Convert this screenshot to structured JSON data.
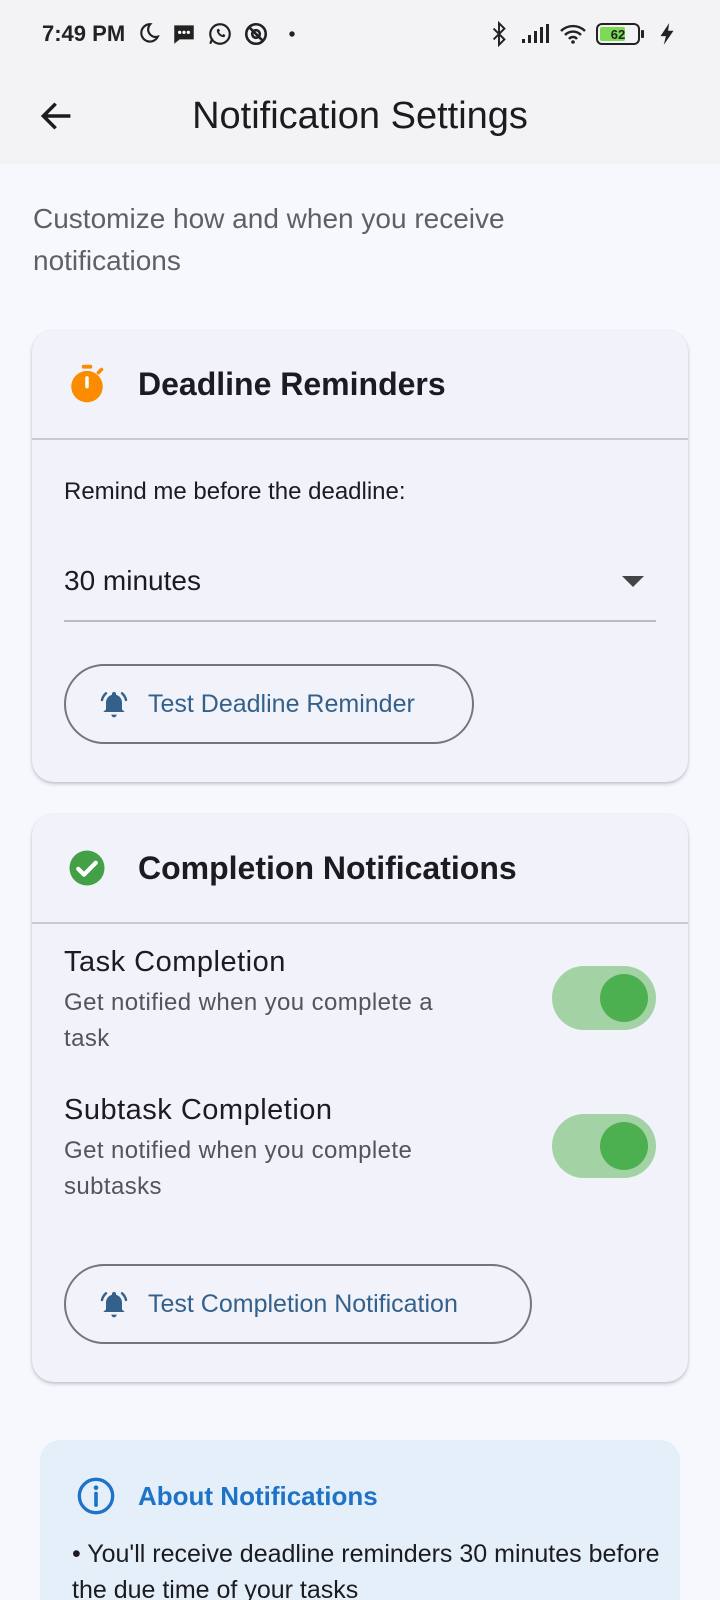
{
  "status_bar": {
    "time": "7:49 PM",
    "battery_level": "62",
    "left_icons": [
      "moon-icon",
      "message-icon",
      "whatsapp-icon",
      "at-sign-icon",
      "dot-icon"
    ],
    "right_icons": [
      "bluetooth-icon",
      "signal-icon",
      "wifi-icon",
      "battery-icon",
      "charging-icon"
    ]
  },
  "app_bar": {
    "title": "Notification Settings",
    "back_icon": "arrow-back-icon"
  },
  "subtitle": "Customize how and when you receive notifications",
  "deadline_card": {
    "title": "Deadline Reminders",
    "icon": "timer-icon",
    "icon_color": "#fb8c00",
    "remind_label": "Remind me before the deadline:",
    "dropdown_value": "30 minutes",
    "test_button_label": "Test Deadline Reminder"
  },
  "completion_card": {
    "title": "Completion Notifications",
    "icon": "check-circle-icon",
    "icon_color": "#43a047",
    "settings": [
      {
        "title": "Task Completion",
        "description": "Get notified when you complete a task",
        "enabled": true
      },
      {
        "title": "Subtask Completion",
        "description": "Get notified when you complete subtasks",
        "enabled": true
      }
    ],
    "test_button_label": "Test Completion Notification"
  },
  "info_card": {
    "title": "About Notifications",
    "icon": "info-icon",
    "body": "• You'll receive deadline reminders 30 minutes before the due time of your tasks"
  },
  "colors": {
    "accent_blue": "#33618c",
    "toggle_track": "#a3d2a4",
    "toggle_thumb": "#4caf50",
    "info_title": "#1e73c6"
  }
}
